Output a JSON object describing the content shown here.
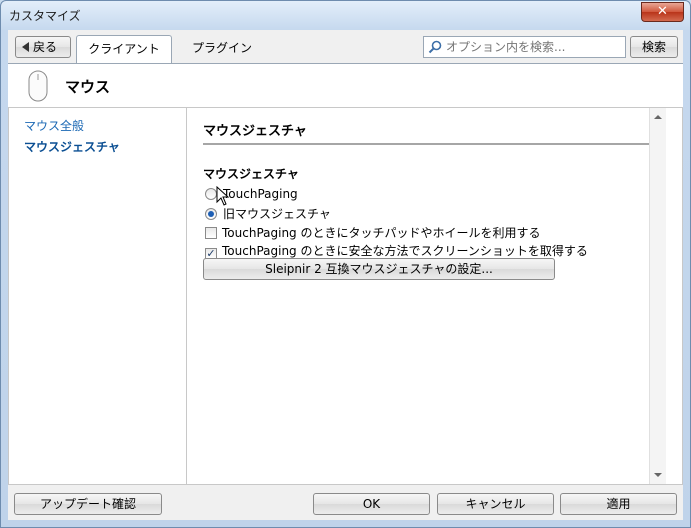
{
  "window": {
    "title": "カスタマイズ",
    "close_glyph": "✕"
  },
  "toolbar": {
    "back_label": "戻る",
    "tabs": [
      {
        "label": "クライアント",
        "active": true
      },
      {
        "label": "プラグイン",
        "active": false
      }
    ],
    "search": {
      "placeholder": "オプション内を検索...",
      "value": ""
    },
    "search_button": "検索"
  },
  "header": {
    "icon": "mouse-icon",
    "title": "マウス"
  },
  "sidebar": {
    "items": [
      {
        "label": "マウス全般",
        "selected": false
      },
      {
        "label": "マウスジェスチャ",
        "selected": true
      }
    ]
  },
  "content": {
    "section_title": "マウスジェスチャ",
    "group_title": "マウスジェスチャ",
    "radio_options": [
      {
        "label": "TouchPaging",
        "checked": false
      },
      {
        "label": "旧マウスジェスチャ",
        "checked": true
      }
    ],
    "checkboxes": [
      {
        "label": "TouchPaging のときにタッチパッドやホイールを利用する",
        "checked": false
      },
      {
        "label": "TouchPaging のときに安全な方法でスクリーンショットを取得する",
        "checked": true
      }
    ],
    "compat_button": "Sleipnir 2 互換マウスジェスチャの設定..."
  },
  "footer": {
    "update_button": "アップデート確認",
    "ok_button": "OK",
    "cancel_button": "キャンセル",
    "apply_button": "適用"
  },
  "colors": {
    "link": "#1b68b4",
    "selected_link": "#0b4f93",
    "close": "#c94a2f"
  }
}
